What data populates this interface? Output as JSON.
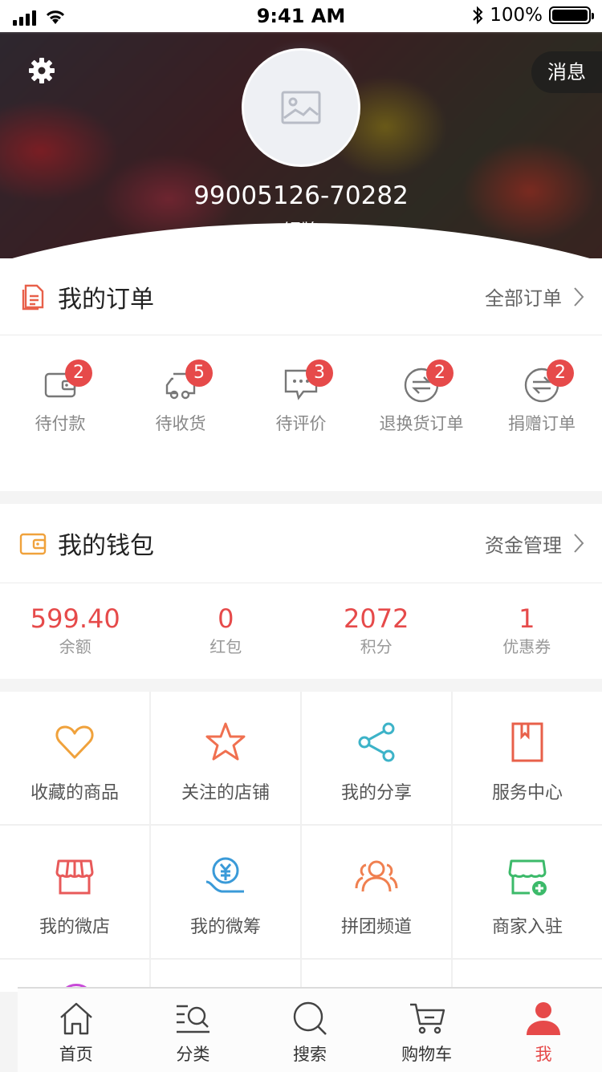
{
  "status_bar": {
    "time": "9:41 AM",
    "battery": "100%"
  },
  "header": {
    "message_button": "消息",
    "username": "99005126-70282",
    "level": "铜牌"
  },
  "orders": {
    "title": "我的订单",
    "link": "全部订单",
    "items": [
      {
        "label": "待付款",
        "badge": "2",
        "icon": "wallet-icon"
      },
      {
        "label": "待收货",
        "badge": "5",
        "icon": "truck-icon"
      },
      {
        "label": "待评价",
        "badge": "3",
        "icon": "comment-icon"
      },
      {
        "label": "退换货订单",
        "badge": "2",
        "icon": "exchange-icon"
      },
      {
        "label": "捐赠订单",
        "badge": "2",
        "icon": "exchange-icon"
      }
    ]
  },
  "wallet": {
    "title": "我的钱包",
    "link": "资金管理",
    "items": [
      {
        "value": "599.40",
        "label": "余额"
      },
      {
        "value": "0",
        "label": "红包"
      },
      {
        "value": "2072",
        "label": "积分"
      },
      {
        "value": "1",
        "label": "优惠券"
      }
    ]
  },
  "services": [
    {
      "label": "收藏的商品",
      "icon": "heart-icon",
      "color": "#f0a23c"
    },
    {
      "label": "关注的店铺",
      "icon": "star-icon",
      "color": "#f07050"
    },
    {
      "label": "我的分享",
      "icon": "share-icon",
      "color": "#3db3c8"
    },
    {
      "label": "服务中心",
      "icon": "book-icon",
      "color": "#e8604a"
    },
    {
      "label": "我的微店",
      "icon": "shop-icon",
      "color": "#e85a5a"
    },
    {
      "label": "我的微筹",
      "icon": "yuan-hand-icon",
      "color": "#3a9ad8"
    },
    {
      "label": "拼团频道",
      "icon": "group-icon",
      "color": "#f08050"
    },
    {
      "label": "商家入驻",
      "icon": "shop-add-icon",
      "color": "#3cba6a"
    }
  ],
  "tabbar": {
    "active": "我",
    "items": [
      {
        "label": "首页",
        "icon": "home-icon"
      },
      {
        "label": "分类",
        "icon": "category-icon"
      },
      {
        "label": "搜索",
        "icon": "search-icon"
      },
      {
        "label": "购物车",
        "icon": "cart-icon"
      },
      {
        "label": "我",
        "icon": "user-icon"
      }
    ]
  }
}
